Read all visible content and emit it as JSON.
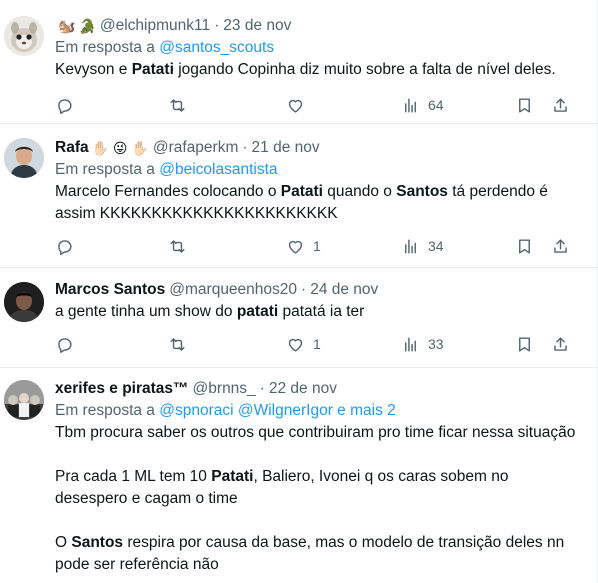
{
  "tweets": [
    {
      "name": "",
      "name_emoji": "🐿️",
      "name_emoji2": "🐊",
      "handle": "@elchipmunk11",
      "dot": "·",
      "date": "23 de nov",
      "reply_prefix": "Em resposta a",
      "reply_mentions": "@santos_scouts",
      "text_parts": [
        "Kevyson e ",
        "Patati",
        " jogando Copinha diz muito sobre a falta de nível deles."
      ],
      "likes": "",
      "views": "64",
      "avatar_color": "#d9d4cc"
    },
    {
      "name": "Rafa",
      "name_emoji": "✋🏻 😜 ✋🏻",
      "handle": "@rafaperkm",
      "dot": "·",
      "date": "21 de nov",
      "reply_prefix": "Em resposta a",
      "reply_mentions": "@beicolasantista",
      "text_parts": [
        "Marcelo Fernandes colocando o ",
        "Patati",
        " quando o ",
        "Santos",
        " tá perdendo é assim KKKKKKKKKKKKKKKKKKKKKKK"
      ],
      "likes": "1",
      "views": "34",
      "avatar_color": "#b7c4cc"
    },
    {
      "name": "Marcos Santos",
      "handle": "@marqueenhos20",
      "dot": "·",
      "date": "24 de nov",
      "text_parts": [
        "a gente tinha um show do ",
        "patati",
        " patatá ia ter"
      ],
      "likes": "1",
      "views": "33",
      "avatar_color": "#2a2a2a"
    },
    {
      "name": "xerifes e piratas™",
      "handle": "@brnns_",
      "dot": "·",
      "date": "22 de nov",
      "reply_prefix": "Em resposta a",
      "reply_mentions": "@spnoraci @WilgnerIgor e mais 2",
      "text_parts": [
        "Tbm procura saber os outros que contribuiram pro time ficar nessa situação",
        "Pra cada 1 ML tem 10 ",
        "Patati",
        ", Baliero, Ivonei q os caras sobem no desespero e cagam o time",
        "O ",
        "Santos",
        " respira por causa da base, mas o modelo de transição deles nn pode ser referência não"
      ],
      "avatar_color": "#8d8d8d"
    }
  ],
  "icons": [
    "reply-icon",
    "retweet-icon",
    "like-icon",
    "views-icon",
    "bookmark-icon",
    "share-icon"
  ],
  "colors": {
    "link": "#1d9bf0",
    "muted": "#536471",
    "text": "#0f1419"
  }
}
